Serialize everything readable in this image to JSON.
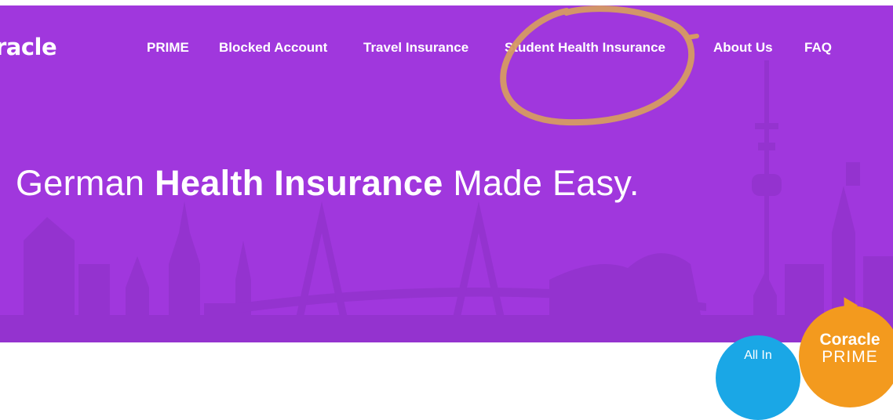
{
  "header": {
    "logo_text": "racle",
    "nav": [
      {
        "label": "PRIME"
      },
      {
        "label": "Blocked Account"
      },
      {
        "label": "Travel Insurance"
      },
      {
        "label": "Student Health Insurance"
      },
      {
        "label": "About Us"
      },
      {
        "label": "FAQ"
      }
    ]
  },
  "hero": {
    "headline_before": "German ",
    "headline_bold": "Health Insurance",
    "headline_after": " Made Easy."
  },
  "badges": {
    "blue_text": "All In",
    "orange_title": "Coracle",
    "orange_subtitle": "PRIME"
  },
  "colors": {
    "hero_bg": "#a037dd",
    "skyline": "#9433cf",
    "annotation_circle": "#d69a62",
    "badge_blue": "#1aa7e6",
    "badge_orange": "#f39a1e"
  },
  "annotation": {
    "shape": "hand-drawn circle",
    "target": "Student Health Insurance"
  }
}
